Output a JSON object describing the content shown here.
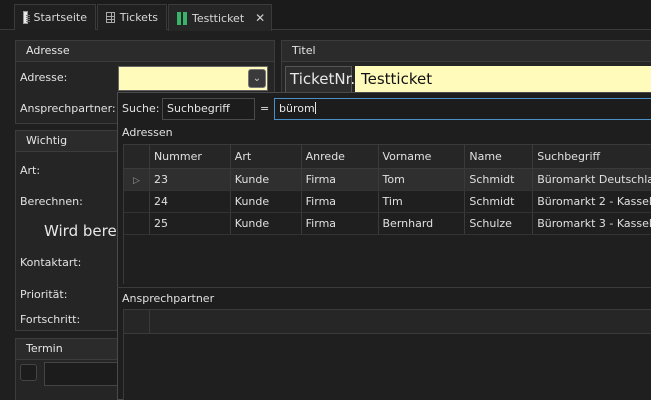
{
  "tabs": [
    {
      "label": "Startseite",
      "icon": "document-icon"
    },
    {
      "label": "Tickets",
      "icon": "grid-icon"
    },
    {
      "label": "Testticket",
      "icon": "ticket-icon",
      "active": true
    }
  ],
  "adresse_panel": {
    "title": "Adresse",
    "adresse_label": "Adresse:",
    "ansprechpartner_label": "Ansprechpartner:"
  },
  "titel_panel": {
    "title": "Titel",
    "prefix": "TicketNr.",
    "value": "Testticket"
  },
  "wichtig_panel": {
    "title": "Wichtig",
    "art_label": "Art:",
    "berechnen_label": "Berechnen:",
    "computing_text": "Wird berec",
    "kontaktart_label": "Kontaktart:",
    "prioritaet_label": "Priorität:",
    "fortschritt_label": "Fortschritt:"
  },
  "termin_panel": {
    "title": "Termin"
  },
  "popup": {
    "search_label": "Suche:",
    "search_field": "Suchbegriff",
    "operator": "=",
    "search_value": "bürom",
    "adressen_label": "Adressen",
    "columns": [
      "Nummer",
      "Art",
      "Anrede",
      "Vorname",
      "Name",
      "Suchbegriff"
    ],
    "rows": [
      [
        "23",
        "Kunde",
        "Firma",
        "Tom",
        "Schmidt",
        "Büromarkt Deutschland"
      ],
      [
        "24",
        "Kunde",
        "Firma",
        "Tim",
        "Schmidt",
        "Büromarkt 2 - Kassel"
      ],
      [
        "25",
        "Kunde",
        "Firma",
        "Bernhard",
        "Schulze",
        "Büromarkt 3 - Kassel"
      ]
    ],
    "ansprechpartner_label": "Ansprechpartner"
  },
  "colors": {
    "accent_green": "#39b36a",
    "input_yellow": "#fffbbb",
    "focus_blue": "#4a90c8"
  }
}
